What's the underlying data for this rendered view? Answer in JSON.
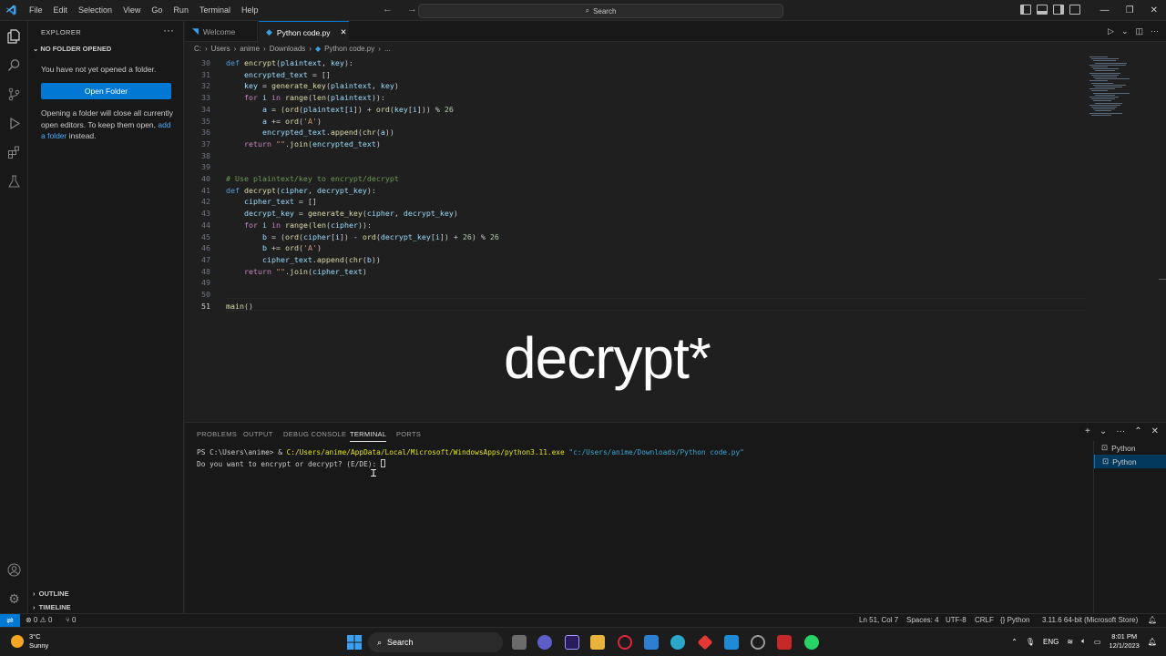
{
  "menu": [
    "File",
    "Edit",
    "Selection",
    "View",
    "Go",
    "Run",
    "Terminal",
    "Help"
  ],
  "command_center": {
    "placeholder": "Search"
  },
  "sidebar": {
    "title": "EXPLORER",
    "section": "NO FOLDER OPENED",
    "message1": "You have not yet opened a folder.",
    "open_folder": "Open Folder",
    "message2_a": "Opening a folder will close all currently open editors. To keep them open,",
    "message2_link": "add a folder",
    "message2_b": "instead.",
    "outline": "OUTLINE",
    "timeline": "TIMELINE"
  },
  "tabs": [
    {
      "label": "Welcome",
      "icon": "vscode-icon"
    },
    {
      "label": "Python code.py",
      "icon": "python-file-icon",
      "active": true
    }
  ],
  "breadcrumb": [
    "C:",
    "Users",
    "anime",
    "Downloads",
    "Python code.py",
    "..."
  ],
  "editor": {
    "line_numbers": [
      "30",
      "31",
      "32",
      "33",
      "34",
      "35",
      "36",
      "37",
      "38",
      "39",
      "40",
      "41",
      "42",
      "43",
      "44",
      "45",
      "46",
      "47",
      "48",
      "49",
      "50",
      "51"
    ]
  },
  "overlay_caption": "decrypt*",
  "panel": {
    "tabs": [
      "PROBLEMS",
      "OUTPUT",
      "DEBUG CONSOLE",
      "TERMINAL",
      "PORTS"
    ],
    "terminal_prompt": "PS C:\\Users\\anime> & ",
    "terminal_exe": "C:/Users/anime/AppData/Local/Microsoft/WindowsApps/python3.11.exe",
    "terminal_arg": "\"c:/Users/anime/Downloads/Python code.py\"",
    "terminal_line2": "Do you want to encrypt or decrypt? (E/DE): ",
    "terminals": [
      "Python",
      "Python"
    ]
  },
  "statusbar": {
    "problems": "⊗ 0 ⚠ 0",
    "ports": "⑂ 0",
    "position": "Ln 51, Col 7",
    "spaces": "Spaces: 4",
    "encoding": "UTF-8",
    "eol": "CRLF",
    "language": "Python",
    "interpreter": "3.11.6 64-bit (Microsoft Store)"
  },
  "taskbar": {
    "weather_temp": "3°C",
    "weather_desc": "Sunny",
    "search": "Search",
    "lang": "ENG",
    "time": "8:01 PM",
    "date": "12/1/2023"
  }
}
